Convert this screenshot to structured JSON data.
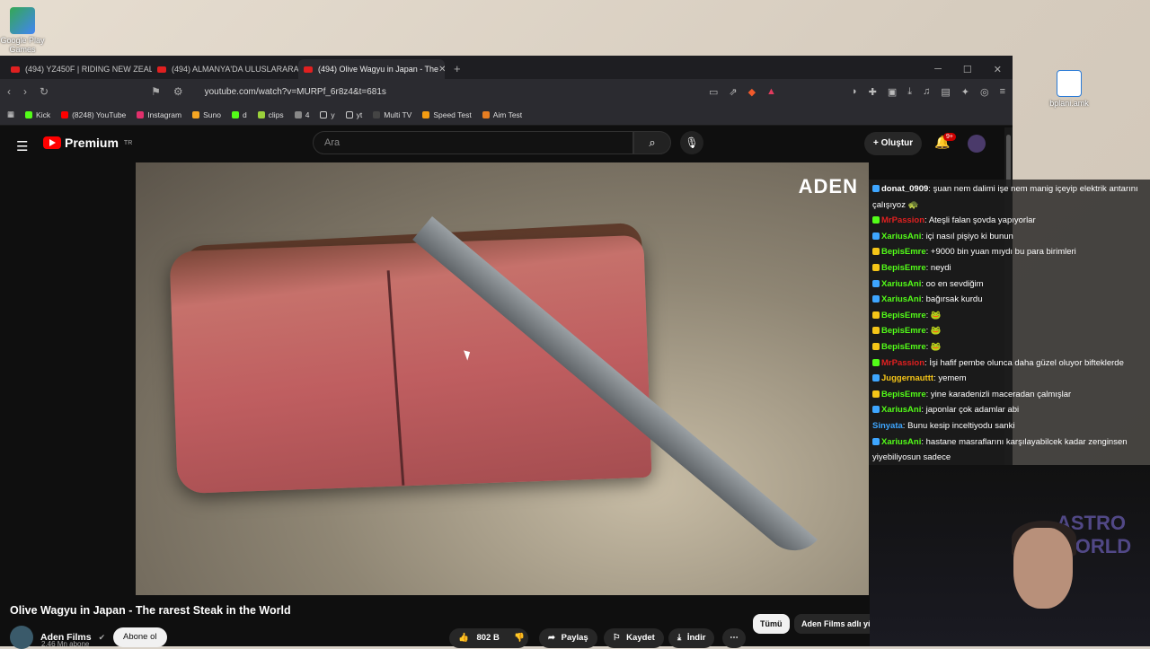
{
  "desktop": {
    "icons": [
      {
        "label_lines": [
          "Google Play",
          "Games"
        ],
        "icon": "google-play-games-icon"
      },
      {
        "label_lines": [
          "bplani.amk"
        ],
        "icon": "file-icon"
      }
    ]
  },
  "browser": {
    "tabs": [
      {
        "label": "(494) YZ450F | RIDING NEW ZEALANI"
      },
      {
        "label": "(494) ALMANYA'DA ULUSLARARASI"
      },
      {
        "label": "(494) Olive Wagyu in Japan - The"
      }
    ],
    "address": "youtube.com/watch?v=MURPf_6r8z4&t=681s",
    "bookmarks": [
      {
        "label": "Kick",
        "color": "#53fc18"
      },
      {
        "label": "(8248) YouTube",
        "color": "#ff0000"
      },
      {
        "label": "Instagram",
        "color": "#e1306c"
      },
      {
        "label": "Suno",
        "color": "#f5a623"
      },
      {
        "label": "d",
        "color": "#53fc18"
      },
      {
        "label": "clips",
        "color": "#9bd13b"
      },
      {
        "label": "4",
        "color": "#888888"
      },
      {
        "label": "y",
        "color": "#cccccc"
      },
      {
        "label": "yt",
        "color": "#cccccc"
      },
      {
        "label": "Multi TV",
        "color": "#cccccc"
      },
      {
        "label": "Speed Test",
        "color": "#f39c12"
      },
      {
        "label": "Aim Test",
        "color": "#e67e22"
      }
    ]
  },
  "youtube": {
    "logo_text": "Premium",
    "region": "TR",
    "search_placeholder": "Ara",
    "create_label": "Oluştur",
    "notif_count": "9+",
    "video_watermark": "ADEN",
    "video_title": "Olive Wagyu in Japan - The rarest Steak in the World",
    "channel_name": "Aden Films",
    "subscribers": "2,46 Mn abone",
    "subscribe_label": "Abone ol",
    "likes": "802 B",
    "share_label": "Paylaş",
    "save_label": "Kaydet",
    "download_label": "İndir",
    "chips": [
      "Tümü",
      "Aden Films adlı yük"
    ]
  },
  "chat": {
    "messages": [
      {
        "user": "donat_0909",
        "user_color": "#ffffff",
        "text": "şuan nem dalimi işe nem manig içeyip elektrik antarını",
        "badge_color": "#3ea6ff"
      },
      {
        "user": "",
        "user_color": "#ffffff",
        "text": "çalışıyoz 🐢",
        "badge_color": ""
      },
      {
        "user": "MrPassion",
        "user_color": "#e02020",
        "text": "Ateşli falan şovda yapıyorlar",
        "badge_color": "#53fc18"
      },
      {
        "user": "XariusAni",
        "user_color": "#53fc18",
        "text": "içi nasıl pişiyo ki bunun",
        "badge_color": "#3ea6ff"
      },
      {
        "user": "BepisEmre",
        "user_color": "#53fc18",
        "text": "+9000 bin yuan mıydı bu para birimleri",
        "badge_color": "#f5c518"
      },
      {
        "user": "BepisEmre",
        "user_color": "#53fc18",
        "text": "neydi",
        "badge_color": "#f5c518"
      },
      {
        "user": "XariusAni",
        "user_color": "#53fc18",
        "text": "oo en sevdiğim",
        "badge_color": "#3ea6ff"
      },
      {
        "user": "XariusAni",
        "user_color": "#53fc18",
        "text": "bağırsak kurdu",
        "badge_color": "#3ea6ff"
      },
      {
        "user": "BepisEmre",
        "user_color": "#53fc18",
        "text": "🐸",
        "badge_color": "#f5c518"
      },
      {
        "user": "BepisEmre",
        "user_color": "#53fc18",
        "text": "🐸",
        "badge_color": "#f5c518"
      },
      {
        "user": "BepisEmre",
        "user_color": "#53fc18",
        "text": "🐸",
        "badge_color": "#f5c518"
      },
      {
        "user": "MrPassion",
        "user_color": "#e02020",
        "text": "İşi hafif pembe olunca daha güzel oluyor bifteklerde",
        "badge_color": "#53fc18"
      },
      {
        "user": "Juggernauttt",
        "user_color": "#f5c518",
        "text": "yemem",
        "badge_color": "#3ea6ff"
      },
      {
        "user": "BepisEmre",
        "user_color": "#53fc18",
        "text": "yine karadenizli maceradan çalmışlar",
        "badge_color": "#f5c518"
      },
      {
        "user": "XariusAni",
        "user_color": "#53fc18",
        "text": "japonlar çok adamlar abi",
        "badge_color": "#3ea6ff"
      },
      {
        "user": "Sinyata",
        "user_color": "#3ea6ff",
        "text": "Bunu kesip inceltiyodu sanki",
        "badge_color": ""
      },
      {
        "user": "XariusAni",
        "user_color": "#53fc18",
        "text": "hastane masraflarını karşılayabilcek kadar zenginsen",
        "badge_color": "#3ea6ff"
      },
      {
        "user": "",
        "user_color": "#ffffff",
        "text": "yiyebiliyosun sadece",
        "badge_color": ""
      }
    ]
  },
  "webcam": {
    "neon_text": "ASTRO WORLD"
  }
}
